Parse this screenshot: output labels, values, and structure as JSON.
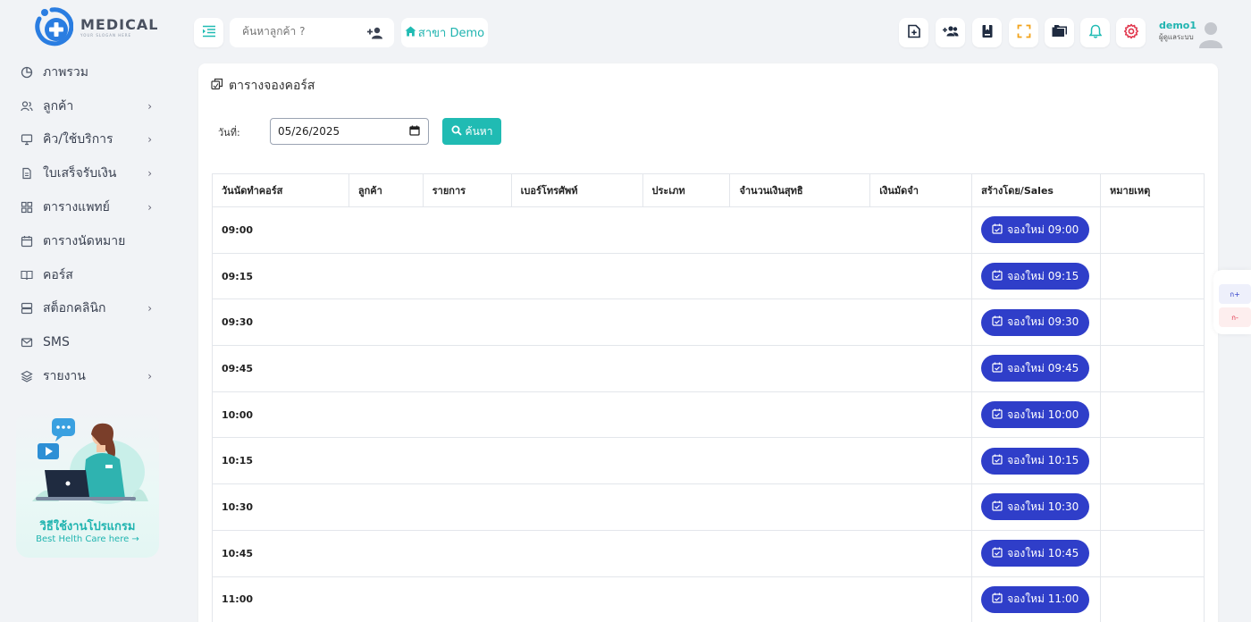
{
  "brand": {
    "name": "MEDICAL",
    "tagline": "YOUR SLOGAN HERE"
  },
  "sidebar": {
    "items": [
      {
        "label": "ภาพรวม",
        "icon": "pie-chart-icon",
        "has_children": false
      },
      {
        "label": "ลูกค้า",
        "icon": "users-icon",
        "has_children": true
      },
      {
        "label": "คิว/ใช้บริการ",
        "icon": "monitor-icon",
        "has_children": true
      },
      {
        "label": "ใบเสร็จรับเงิน",
        "icon": "document-icon",
        "has_children": true
      },
      {
        "label": "ตารางแพทย์",
        "icon": "grid-icon",
        "has_children": true
      },
      {
        "label": "ตารางนัดหมาย",
        "icon": "calendar-icon",
        "has_children": false
      },
      {
        "label": "คอร์ส",
        "icon": "book-icon",
        "has_children": false
      },
      {
        "label": "สต็อกคลินิก",
        "icon": "server-icon",
        "has_children": true
      },
      {
        "label": "SMS",
        "icon": "mail-icon",
        "has_children": false
      },
      {
        "label": "รายงาน",
        "icon": "layers-icon",
        "has_children": true
      }
    ],
    "help": {
      "title": "วิธีใช้งานโปรแกรม",
      "link": "Best Helth Care here →"
    }
  },
  "topbar": {
    "search_placeholder": "ค้นหาลูกค้า ?",
    "branch_label": "สาขา Demo",
    "user_name": "demo1",
    "user_role": "ผู้ดูแลระบบ"
  },
  "page": {
    "title": "ตารางจองคอร์ส",
    "date_label": "วันที่:",
    "date_value": "05/26/2025",
    "search_label": "ค้นหา"
  },
  "table": {
    "headers": [
      "วันนัดทำคอร์ส",
      "ลูกค้า",
      "รายการ",
      "เบอร์โทรศัพท์",
      "ประเภท",
      "จำนวนเงินสุทธิ",
      "เงินมัดจำ",
      "สร้างโดย/Sales",
      "หมายเหตุ"
    ],
    "rows": [
      {
        "time": "09:00",
        "action": "จองใหม่ 09:00"
      },
      {
        "time": "09:15",
        "action": "จองใหม่ 09:15"
      },
      {
        "time": "09:30",
        "action": "จองใหม่ 09:30"
      },
      {
        "time": "09:45",
        "action": "จองใหม่ 09:45"
      },
      {
        "time": "10:00",
        "action": "จองใหม่ 10:00"
      },
      {
        "time": "10:15",
        "action": "จองใหม่ 10:15"
      },
      {
        "time": "10:30",
        "action": "จองใหม่ 10:30"
      },
      {
        "time": "10:45",
        "action": "จองใหม่ 10:45"
      },
      {
        "time": "11:00",
        "action": "จองใหม่ 11:00"
      }
    ]
  },
  "font_tool": {
    "increase": "ก+",
    "decrease": "ก-"
  },
  "colors": {
    "accent": "#20bbb3",
    "primary_button": "#2f3ec9",
    "logo_blue": "#2a7de1"
  }
}
